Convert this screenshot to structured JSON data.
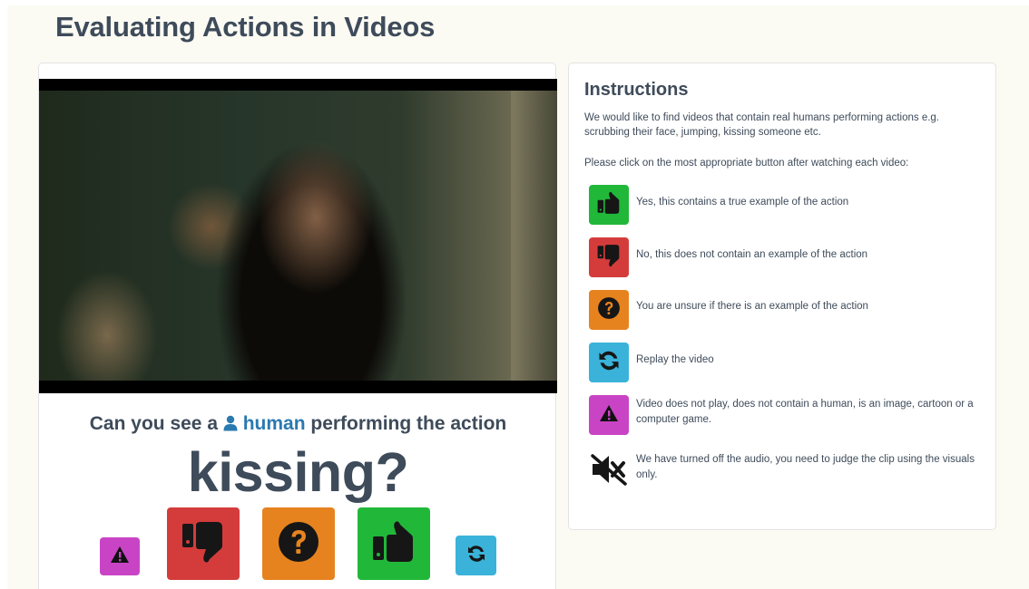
{
  "page": {
    "title": "Evaluating Actions in Videos"
  },
  "task": {
    "question_prefix": "Can you see a",
    "subject": "human",
    "question_suffix": "performing the action",
    "action": "kissing?"
  },
  "buttons": {
    "invalid": {
      "icon": "warning-icon",
      "color": "#c944c5"
    },
    "no": {
      "icon": "thumbs-down-icon",
      "color": "#d43c3c"
    },
    "unsure": {
      "icon": "question-circle-icon",
      "color": "#e6831f"
    },
    "yes": {
      "icon": "thumbs-up-icon",
      "color": "#21b83a"
    },
    "replay": {
      "icon": "refresh-icon",
      "color": "#3ab2d9"
    }
  },
  "instructions": {
    "title": "Instructions",
    "intro": "We would like to find videos that contain real humans performing actions e.g. scrubbing their face, jumping, kissing someone etc.",
    "prompt": "Please click on the most appropriate button after watching each video:",
    "legend": [
      {
        "icon": "thumbs-up-icon",
        "label": "Yes, this contains a true example of the action"
      },
      {
        "icon": "thumbs-down-icon",
        "label": "No, this does not contain an example of the action"
      },
      {
        "icon": "question-circle-icon",
        "label": "You are unsure if there is an example of the action"
      },
      {
        "icon": "refresh-icon",
        "label": "Replay the video"
      },
      {
        "icon": "warning-icon",
        "label": "Video does not play, does not contain a human, is an image, cartoon or a computer game."
      },
      {
        "icon": "volume-off-icon",
        "label": "We have turned off the audio, you need to judge the clip using the visuals only."
      }
    ]
  }
}
